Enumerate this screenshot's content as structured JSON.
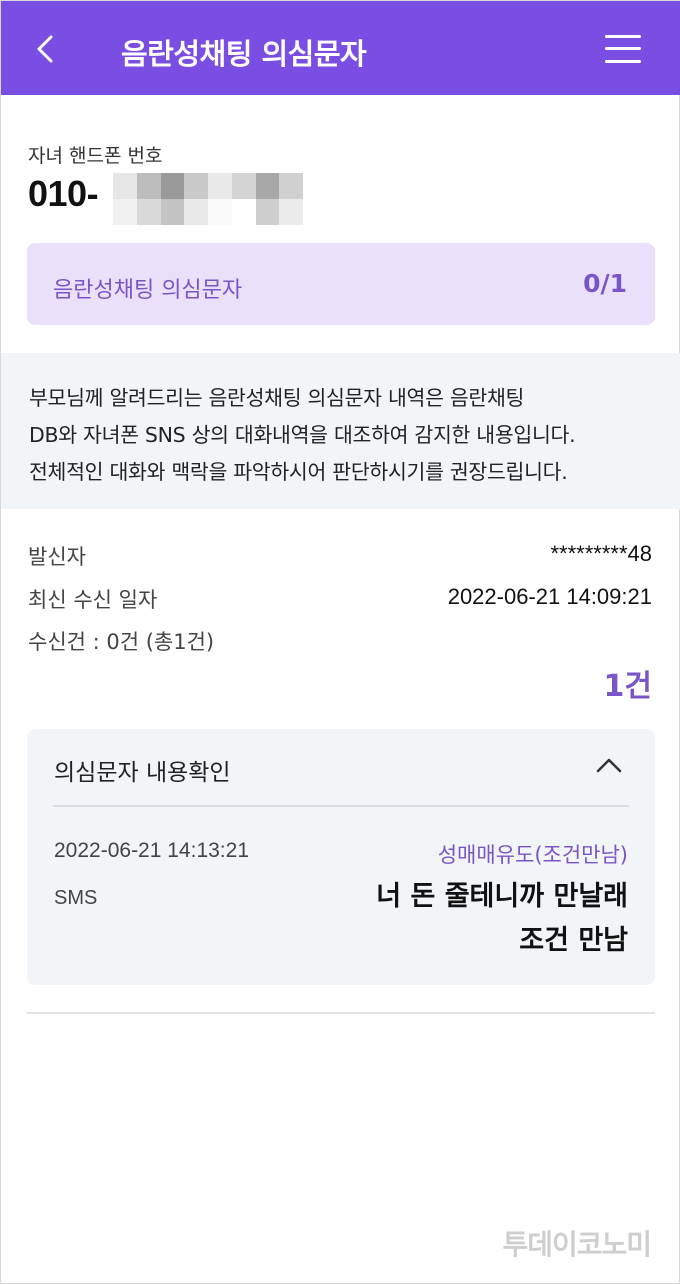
{
  "colors": {
    "accent": "#7b4ee3",
    "accent_text": "#7a55c8",
    "card_bg": "#ebe0fa",
    "panel_bg": "#f2f5f8"
  },
  "header": {
    "back_icon": "chevron-left-icon",
    "title": "음란성채팅 의심문자",
    "menu_icon": "hamburger-menu-icon"
  },
  "child_phone": {
    "label": "자녀 핸드폰 번호",
    "number_prefix": "010-"
  },
  "summary": {
    "label": "음란성채팅 의심문자",
    "count": "0/1"
  },
  "notice": {
    "lines": [
      "부모님께 알려드리는 음란성채팅 의심문자 내역은 음란채팅",
      "DB와 자녀폰 SNS 상의 대화내역을 대조하여 감지한 내용입니다.",
      "전체적인 대화와 맥락을 파악하시어 판단하시기를 권장드립니다."
    ]
  },
  "info": {
    "sender_label": "발신자",
    "sender_value": "*********48",
    "latest_label": "최신 수신 일자",
    "latest_value": "2022-06-21 14:09:21",
    "received_label": "수신건 : 0건 (총1건)"
  },
  "total": "1건",
  "detail": {
    "title": "의심문자 내용확인",
    "toggle_icon": "chevron-up-icon",
    "message": {
      "date": "2022-06-21 14:13:21",
      "type": "SMS",
      "category": "성매매유도(조건만남)",
      "body_lines": [
        "너 돈 줄테니까 만날래",
        "조건 만남"
      ]
    }
  },
  "watermark": "투데이코노미"
}
